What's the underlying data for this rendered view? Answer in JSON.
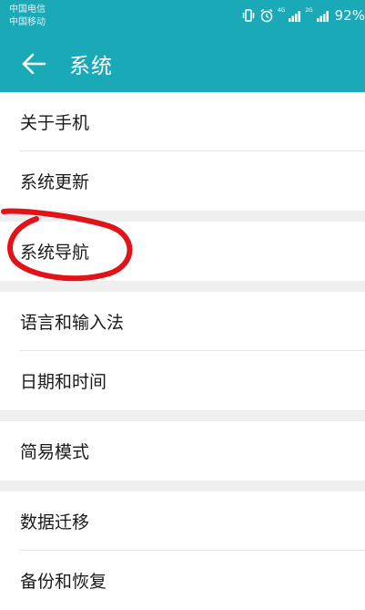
{
  "status_bar": {
    "carrier_1": "中国电信",
    "carrier_2": "中国移动",
    "net_1": "4G",
    "net_2": "2G",
    "battery": "92%"
  },
  "toolbar": {
    "title": "系统"
  },
  "groups": [
    {
      "items": [
        "关于手机",
        "系统更新"
      ]
    },
    {
      "items": [
        "系统导航"
      ]
    },
    {
      "items": [
        "语言和输入法",
        "日期和时间"
      ]
    },
    {
      "items": [
        "简易模式"
      ]
    },
    {
      "items": [
        "数据迁移",
        "备份和恢复"
      ]
    }
  ],
  "colors": {
    "header": "#1aaab7",
    "annotation": "#e01318",
    "background": "#efeff0"
  }
}
